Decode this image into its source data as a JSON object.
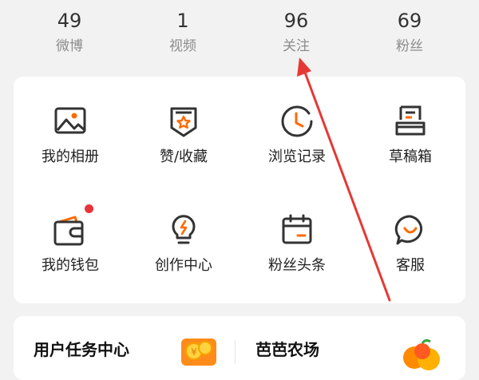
{
  "stats": [
    {
      "value": "49",
      "label": "微博"
    },
    {
      "value": "1",
      "label": "视频"
    },
    {
      "value": "96",
      "label": "关注"
    },
    {
      "value": "69",
      "label": "粉丝"
    }
  ],
  "grid": {
    "items": [
      {
        "label": "我的相册",
        "icon": "photo-album-icon"
      },
      {
        "label": "赞/收藏",
        "icon": "favorite-star-icon"
      },
      {
        "label": "浏览记录",
        "icon": "history-clock-icon"
      },
      {
        "label": "草稿箱",
        "icon": "draft-box-icon"
      },
      {
        "label": "我的钱包",
        "icon": "wallet-icon"
      },
      {
        "label": "创作中心",
        "icon": "lightbulb-icon"
      },
      {
        "label": "粉丝头条",
        "icon": "calendar-icon"
      },
      {
        "label": "客服",
        "icon": "chat-bubble-icon"
      }
    ]
  },
  "tasks": {
    "left_title": "用户任务中心",
    "right_title": "芭芭农场"
  },
  "colors": {
    "accent": "#ff6a00",
    "icon_stroke": "#333333",
    "badge": "#e8333a",
    "annotation": "#e53935"
  }
}
